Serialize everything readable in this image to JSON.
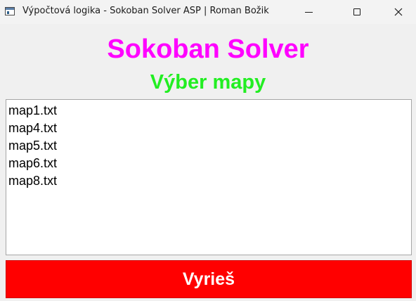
{
  "window": {
    "title": "Výpočtová logika - Sokoban Solver ASP | Roman Božik",
    "icon": "app-window-icon",
    "controls": {
      "minimize_icon": "minimize-icon",
      "maximize_icon": "maximize-icon",
      "close_glyph": "✕"
    }
  },
  "main": {
    "title": "Sokoban Solver",
    "subtitle": "Výber mapy",
    "title_color": "#ff00ff",
    "subtitle_color": "#22ee22"
  },
  "map_list": {
    "items": [
      "map1.txt",
      "map4.txt",
      "map5.txt",
      "map6.txt",
      "map8.txt"
    ]
  },
  "solve_button": {
    "label": "Vyrieš",
    "background": "#ff0000",
    "text_color": "#ffffff"
  }
}
